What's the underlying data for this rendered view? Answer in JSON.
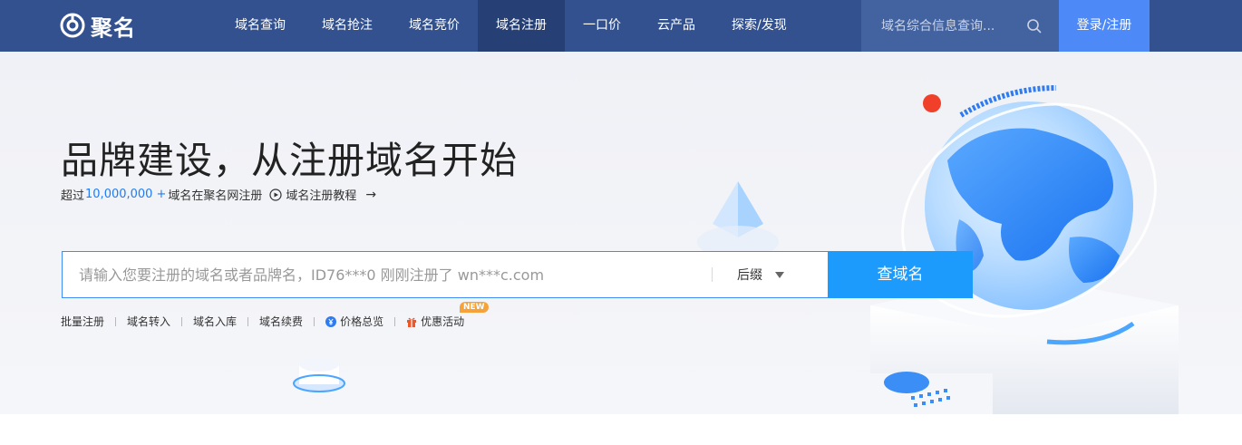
{
  "header": {
    "logo_text": "聚名",
    "nav": [
      {
        "label": "域名查询"
      },
      {
        "label": "域名抢注"
      },
      {
        "label": "域名竞价"
      },
      {
        "label": "域名注册"
      },
      {
        "label": "一口价"
      },
      {
        "label": "云产品"
      },
      {
        "label": "探索/发现"
      }
    ],
    "active_nav_index": 3,
    "search_placeholder": "域名综合信息查询...",
    "login_label": "登录/注册"
  },
  "hero": {
    "headline": "品牌建设，从注册域名开始",
    "sub_prefix": "超过",
    "sub_count": "10,000,000",
    "sub_plus": "+",
    "sub_suffix": "域名在聚名网注册",
    "tutorial_label": "域名注册教程",
    "arrow": "→",
    "search_placeholder": "请输入您要注册的域名或者品牌名，ID76***0 刚刚注册了 wn***c.com",
    "suffix_label": "后缀",
    "query_button": "查域名",
    "quick_links": [
      {
        "label": "批量注册"
      },
      {
        "label": "域名转入"
      },
      {
        "label": "域名入库"
      },
      {
        "label": "域名续费"
      },
      {
        "label": "价格总览",
        "icon": "yen-circle-icon"
      },
      {
        "label": "优惠活动",
        "icon": "gift-icon",
        "badge": "NEW"
      }
    ]
  },
  "colors": {
    "nav_bg": "#33518f",
    "nav_active": "#263f75",
    "login_bg": "#4e8af7",
    "query_btn": "#1c9bfd",
    "accent_text": "#1d7cf6",
    "badge": "#f6a23a"
  }
}
